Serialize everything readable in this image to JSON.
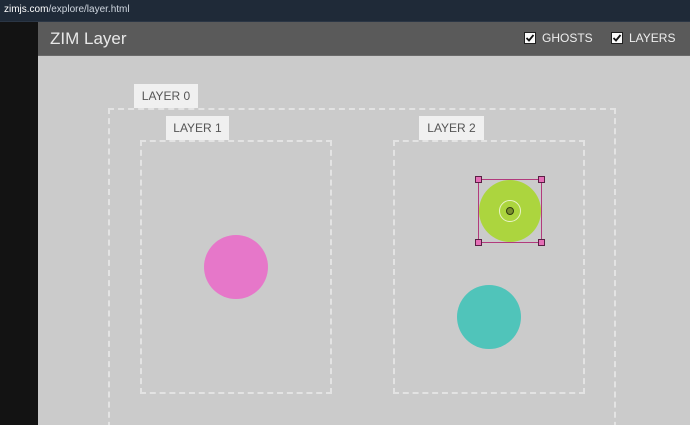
{
  "browser": {
    "url_host": "zimjs.com",
    "url_path": "/explore/layer.html"
  },
  "app": {
    "title": "ZIM Layer",
    "toggles": [
      {
        "label": "GHOSTS",
        "checked": true
      },
      {
        "label": "LAYERS",
        "checked": true
      }
    ]
  },
  "layers": {
    "layer0": {
      "label": "LAYER 0"
    },
    "layer1": {
      "label": "LAYER 1"
    },
    "layer2": {
      "label": "LAYER 2"
    }
  },
  "shapes": {
    "pink": {
      "color": "#e677c9"
    },
    "green": {
      "color": "#acd53e",
      "selected": true
    },
    "teal": {
      "color": "#50c4ba"
    }
  },
  "colors": {
    "header": "#5a5a5a",
    "stage": "#cbcbcb",
    "handle": "#e46fb6"
  }
}
